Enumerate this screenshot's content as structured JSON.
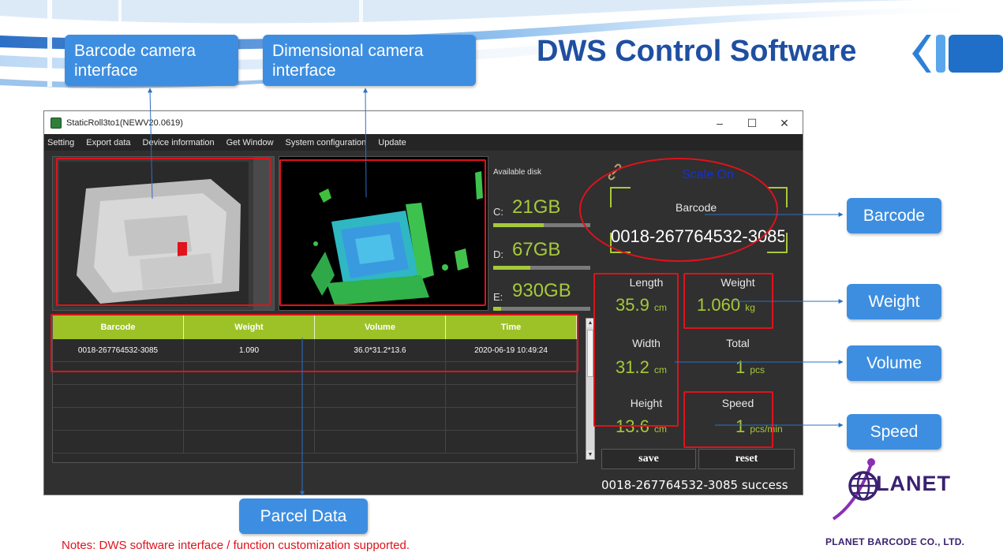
{
  "slide": {
    "title": "DWS Control Software",
    "notes": "Notes:  DWS software interface / function customization supported.",
    "company": "PLANET BARCODE CO., LTD.",
    "logo_text": "LANET"
  },
  "callouts": {
    "barcode_camera": [
      "Barcode camera",
      "interface"
    ],
    "dimensional_camera": [
      "Dimensional camera",
      "interface"
    ],
    "parcel_data": "Parcel Data",
    "barcode": "Barcode",
    "weight": "Weight",
    "volume": "Volume",
    "speed": "Speed"
  },
  "window": {
    "title": "StaticRoll3to1(NEWV20.0619)",
    "controls": {
      "minimize": "–",
      "maximize": "☐",
      "close": "✕"
    },
    "menu": [
      "Setting",
      "Export data",
      "Device information",
      "Get Window",
      "System configuration",
      "Update"
    ]
  },
  "disk": {
    "title": "Available disk",
    "drives": [
      {
        "label": "C:",
        "value": "21GB",
        "used_fraction": 0.52
      },
      {
        "label": "D:",
        "value": "67GB",
        "used_fraction": 0.38
      },
      {
        "label": "E:",
        "value": "930GB",
        "used_fraction": 0.08
      }
    ]
  },
  "scan": {
    "scale_status": "Scale On",
    "barcode_label": "Barcode",
    "barcode_value": "0018-267764532-3085"
  },
  "metrics": {
    "length": {
      "label": "Length",
      "value": "35.9",
      "unit": "cm"
    },
    "weight": {
      "label": "Weight",
      "value": "1.060",
      "unit": "kg"
    },
    "width": {
      "label": "Width",
      "value": "31.2",
      "unit": "cm"
    },
    "total": {
      "label": "Total",
      "value": "1",
      "unit": "pcs"
    },
    "height": {
      "label": "Height",
      "value": "13.6",
      "unit": "cm"
    },
    "speed": {
      "label": "Speed",
      "value": "1",
      "unit": "pcs/min"
    }
  },
  "buttons": {
    "save": "save",
    "reset": "reset"
  },
  "status_message": "0018-267764532-3085 success",
  "table": {
    "columns": [
      "Barcode",
      "Weight",
      "Volume",
      "Time"
    ],
    "rows": [
      [
        "0018-267764532-3085",
        "1.090",
        "36.0*31.2*13.6",
        "2020-06-19 10:49:24"
      ],
      [
        "",
        "",
        "",
        ""
      ],
      [
        "",
        "",
        "",
        ""
      ],
      [
        "",
        "",
        "",
        ""
      ],
      [
        "",
        "",
        "",
        ""
      ]
    ]
  },
  "colors": {
    "title_blue": "#1f4fa0",
    "callout_blue": "#3d8ee0",
    "accent_green": "#a6c93a",
    "highlight_red": "#e0121b",
    "brand_purple": "#3a2170"
  }
}
